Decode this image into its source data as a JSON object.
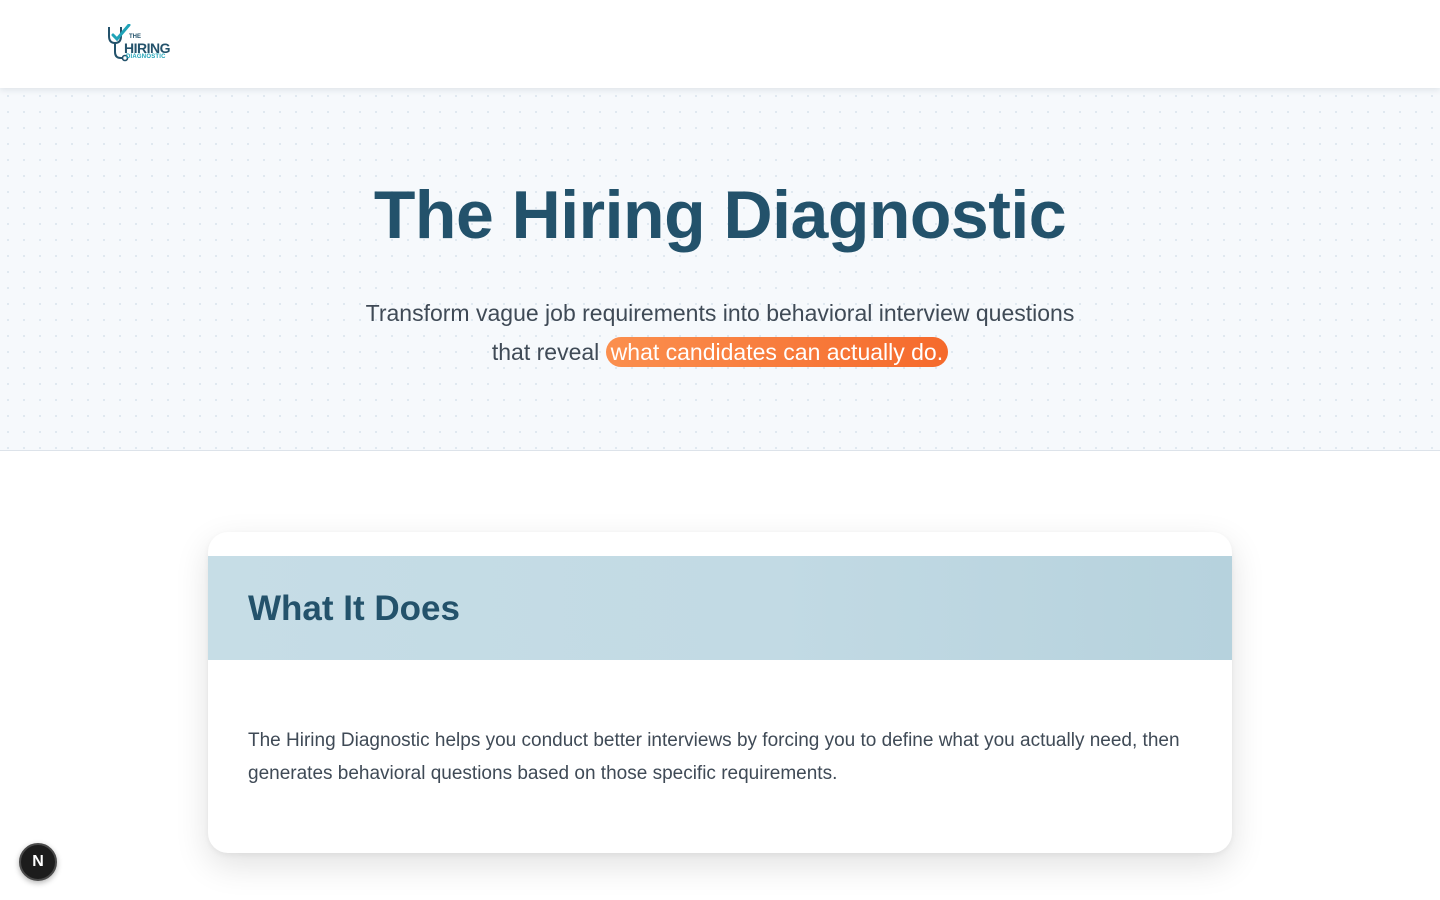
{
  "header": {
    "logo": {
      "line1": "THE",
      "line2": "HIRING",
      "line3": "DIAGNOSTIC"
    }
  },
  "hero": {
    "title": "The Hiring Diagnostic",
    "subtitle_line1": "Transform vague job requirements into behavioral interview questions",
    "subtitle_prefix": "that reveal",
    "subtitle_highlight": "what candidates can actually do."
  },
  "card": {
    "title": "What It Does",
    "body": "The Hiring Diagnostic helps you conduct better interviews by forcing you to define what you actually need, then generates behavioral questions based on those specific requirements."
  },
  "dev_badge": {
    "label": "N"
  },
  "colors": {
    "brand": "#23526b",
    "accent": "#f56a2c",
    "teal": "#1fa3b8"
  }
}
